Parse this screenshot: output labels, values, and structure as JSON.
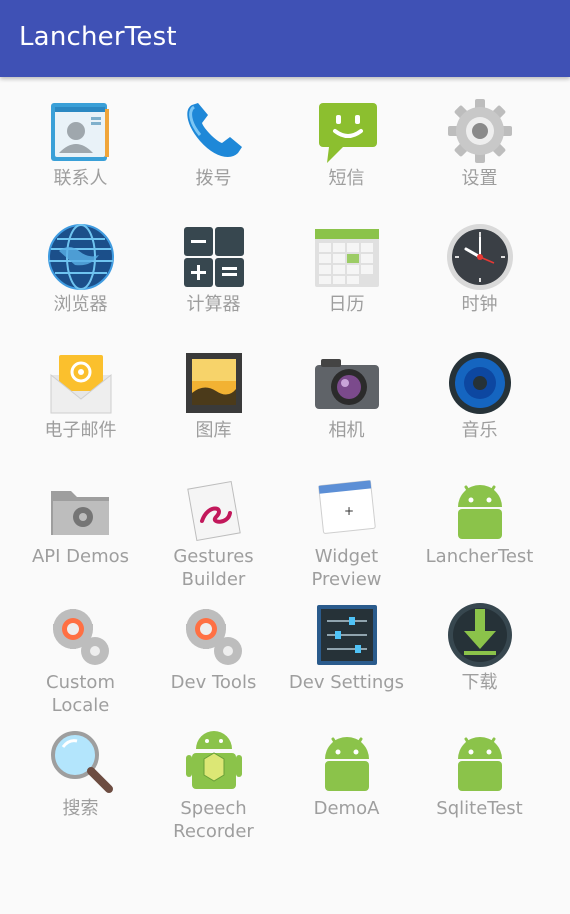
{
  "appbar": {
    "title": "LancherTest"
  },
  "apps": [
    {
      "label": "联系人",
      "icon": "contacts-icon"
    },
    {
      "label": "拨号",
      "icon": "phone-icon"
    },
    {
      "label": "短信",
      "icon": "messaging-icon"
    },
    {
      "label": "设置",
      "icon": "settings-gear-icon"
    },
    {
      "label": "浏览器",
      "icon": "browser-globe-icon"
    },
    {
      "label": "计算器",
      "icon": "calculator-icon"
    },
    {
      "label": "日历",
      "icon": "calendar-icon"
    },
    {
      "label": "时钟",
      "icon": "clock-icon"
    },
    {
      "label": "电子邮件",
      "icon": "email-icon"
    },
    {
      "label": "图库",
      "icon": "gallery-icon"
    },
    {
      "label": "相机",
      "icon": "camera-icon"
    },
    {
      "label": "音乐",
      "icon": "music-speaker-icon"
    },
    {
      "label": "API Demos",
      "icon": "folder-gear-icon"
    },
    {
      "label": "Gestures Builder",
      "icon": "gestures-icon"
    },
    {
      "label": "Widget Preview",
      "icon": "widget-preview-icon"
    },
    {
      "label": "LancherTest",
      "icon": "android-robot-icon"
    },
    {
      "label": "Custom Locale",
      "icon": "dev-gears-icon"
    },
    {
      "label": "Dev Tools",
      "icon": "dev-gears-icon"
    },
    {
      "label": "Dev Settings",
      "icon": "sliders-icon"
    },
    {
      "label": "下载",
      "icon": "download-icon"
    },
    {
      "label": "搜索",
      "icon": "search-magnifier-icon"
    },
    {
      "label": "Speech Recorder",
      "icon": "android-cube-icon"
    },
    {
      "label": "DemoA",
      "icon": "android-robot-icon"
    },
    {
      "label": "SqliteTest",
      "icon": "android-robot-icon"
    }
  ]
}
